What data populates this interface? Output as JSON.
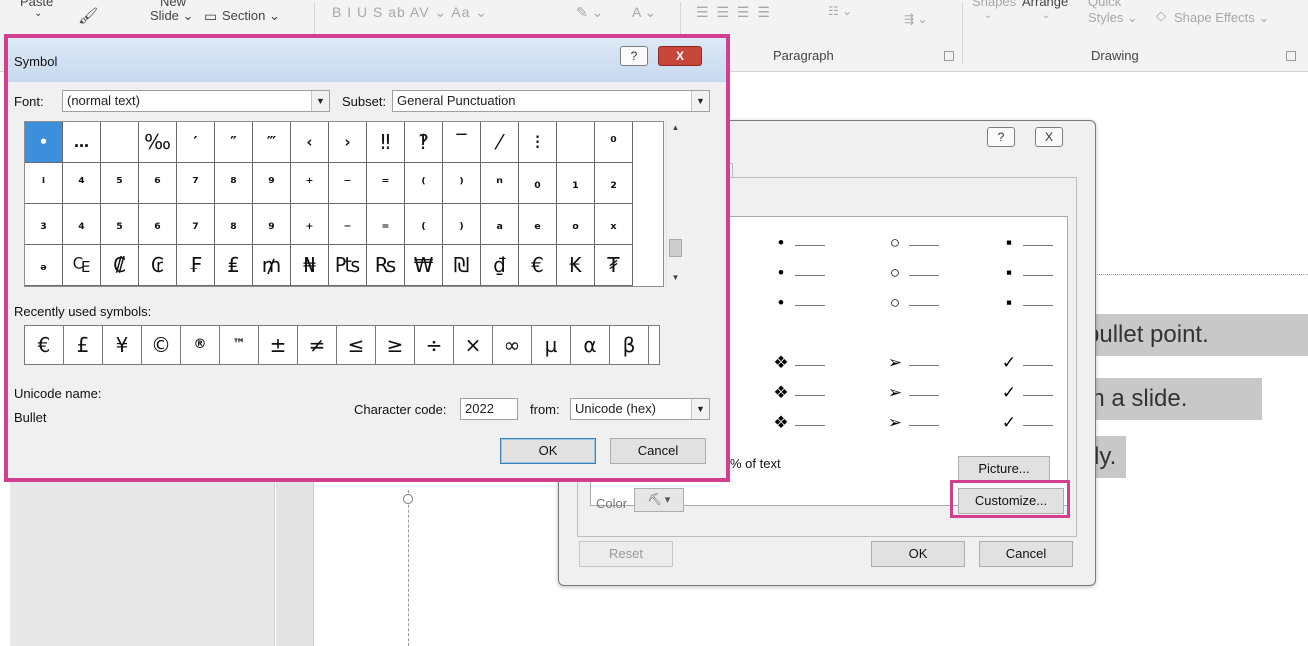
{
  "ribbon": {
    "paste_label": "Paste",
    "new_slide_label": "New",
    "slide_label": "Slide ⌄",
    "section_label": "Section ⌄",
    "font_format_glyphs": "B  I  U  S  ab  AV ⌄  Aa ⌄",
    "font_color_glyphs": "A ⌄",
    "paragraph_glyphs": "☰  ☰  ☰  ☰",
    "shapes_label": "Shapes",
    "arrange_label": "Arrange",
    "quick_label": "Quick",
    "styles_label": "Styles ⌄",
    "shape_effects_label": "Shape Effects ⌄",
    "group_paragraph": "Paragraph",
    "group_drawing": "Drawing"
  },
  "slide": {
    "lines": [
      "bullet point.",
      "in a slide.",
      "dy."
    ]
  },
  "bullets_dialog": {
    "help": "?",
    "close": "X",
    "grid": [
      [
        "•",
        "○",
        "▪"
      ],
      [
        "•",
        "○",
        "▪"
      ],
      [
        "•",
        "○",
        "▪"
      ],
      [
        "❖",
        "➢",
        "✓"
      ],
      [
        "❖",
        "➢",
        "✓"
      ],
      [
        "❖",
        "➢",
        "✓"
      ]
    ],
    "size_suffix": "% of text",
    "color_label": "Color",
    "picture_button": "Picture...",
    "customize_button": "Customize...",
    "reset_button": "Reset",
    "ok_button": "OK",
    "cancel_button": "Cancel"
  },
  "symbol_dialog": {
    "title": "Symbol",
    "help": "?",
    "close": "X",
    "font_label": "Font:",
    "font_value": "(normal text)",
    "subset_label": "Subset:",
    "subset_value": "General Punctuation",
    "grid": [
      [
        "•",
        "…",
        "",
        "‰",
        "′",
        "″",
        "‴",
        "‹",
        "›",
        "‼",
        "‽",
        "‾",
        "⁄",
        "⁝",
        "",
        "⁰"
      ],
      [
        "ⁱ",
        "⁴",
        "⁵",
        "⁶",
        "⁷",
        "⁸",
        "⁹",
        "⁺",
        "⁻",
        "⁼",
        "⁽",
        "⁾",
        "ⁿ",
        "₀",
        "₁",
        "₂"
      ],
      [
        "₃",
        "₄",
        "₅",
        "₆",
        "₇",
        "₈",
        "₉",
        "₊",
        "₋",
        "₌",
        "₍",
        "₎",
        "ₐ",
        "ₑ",
        "ₒ",
        "ₓ"
      ],
      [
        "ₔ",
        "₠",
        "₡",
        "₢",
        "₣",
        "₤",
        "₥",
        "₦",
        "₧",
        "₨",
        "₩",
        "₪",
        "₫",
        "€",
        "₭",
        "₮"
      ]
    ],
    "recent_label": "Recently used symbols:",
    "recent": [
      "€",
      "£",
      "¥",
      "©",
      "®",
      "™",
      "±",
      "≠",
      "≤",
      "≥",
      "÷",
      "×",
      "∞",
      "µ",
      "α",
      "β"
    ],
    "unicode_name_label": "Unicode name:",
    "unicode_name_value": "Bullet",
    "char_code_label": "Character code:",
    "char_code_value": "2022",
    "from_label": "from:",
    "from_value": "Unicode (hex)",
    "ok_button": "OK",
    "cancel_button": "Cancel"
  },
  "colors": {
    "highlight": "#d13f8e",
    "selected_cell": "#3b8fdd"
  }
}
